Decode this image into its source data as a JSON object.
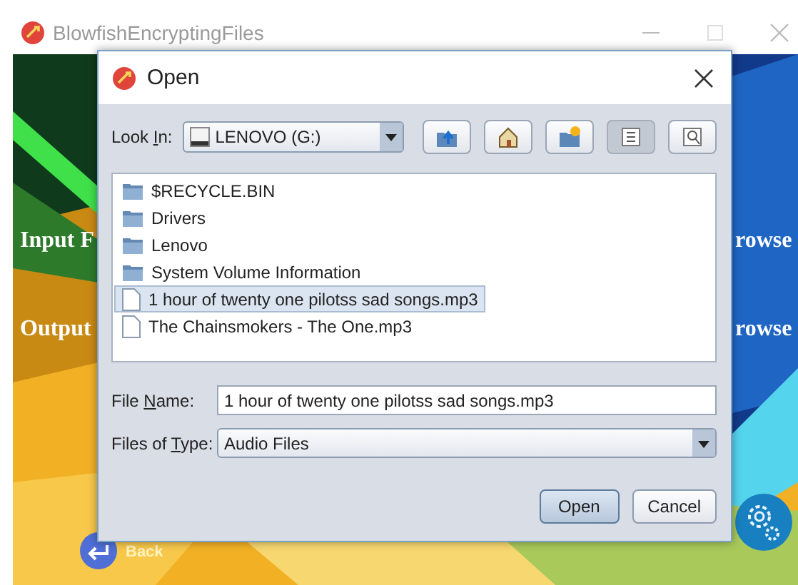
{
  "window": {
    "title": "BlowfishEncryptingFiles"
  },
  "main_form": {
    "input_label": "Input F",
    "input_browse": "rowse",
    "output_label": "Output",
    "output_browse": "rowse",
    "back_label": "Back"
  },
  "dialog": {
    "title": "Open",
    "look_in": {
      "label_parts": [
        "Look ",
        "I",
        "n:"
      ],
      "value": "LENOVO (G:)"
    },
    "toolbar": [
      {
        "kind": "up",
        "selected": false
      },
      {
        "kind": "home",
        "selected": false
      },
      {
        "kind": "new-folder",
        "selected": false
      },
      {
        "kind": "list",
        "selected": true
      },
      {
        "kind": "details",
        "selected": false
      }
    ],
    "files": [
      {
        "kind": "folder",
        "name": "$RECYCLE.BIN",
        "selected": false
      },
      {
        "kind": "folder",
        "name": "Drivers",
        "selected": false
      },
      {
        "kind": "folder",
        "name": "Lenovo",
        "selected": false
      },
      {
        "kind": "folder",
        "name": "System Volume Information",
        "selected": false
      },
      {
        "kind": "file",
        "name": "1 hour of twenty one pilotss sad songs.mp3",
        "selected": true
      },
      {
        "kind": "file",
        "name": "The Chainsmokers - The One.mp3",
        "selected": false
      }
    ],
    "file_name": {
      "label_parts": [
        "File ",
        "N",
        "ame:"
      ],
      "value": "1 hour of twenty one pilotss sad songs.mp3"
    },
    "file_type": {
      "label_parts": [
        "Files of ",
        "T",
        "ype:"
      ],
      "value": "Audio Files"
    },
    "buttons": [
      {
        "label": "Open",
        "default": true
      },
      {
        "label": "Cancel",
        "default": false
      }
    ]
  }
}
